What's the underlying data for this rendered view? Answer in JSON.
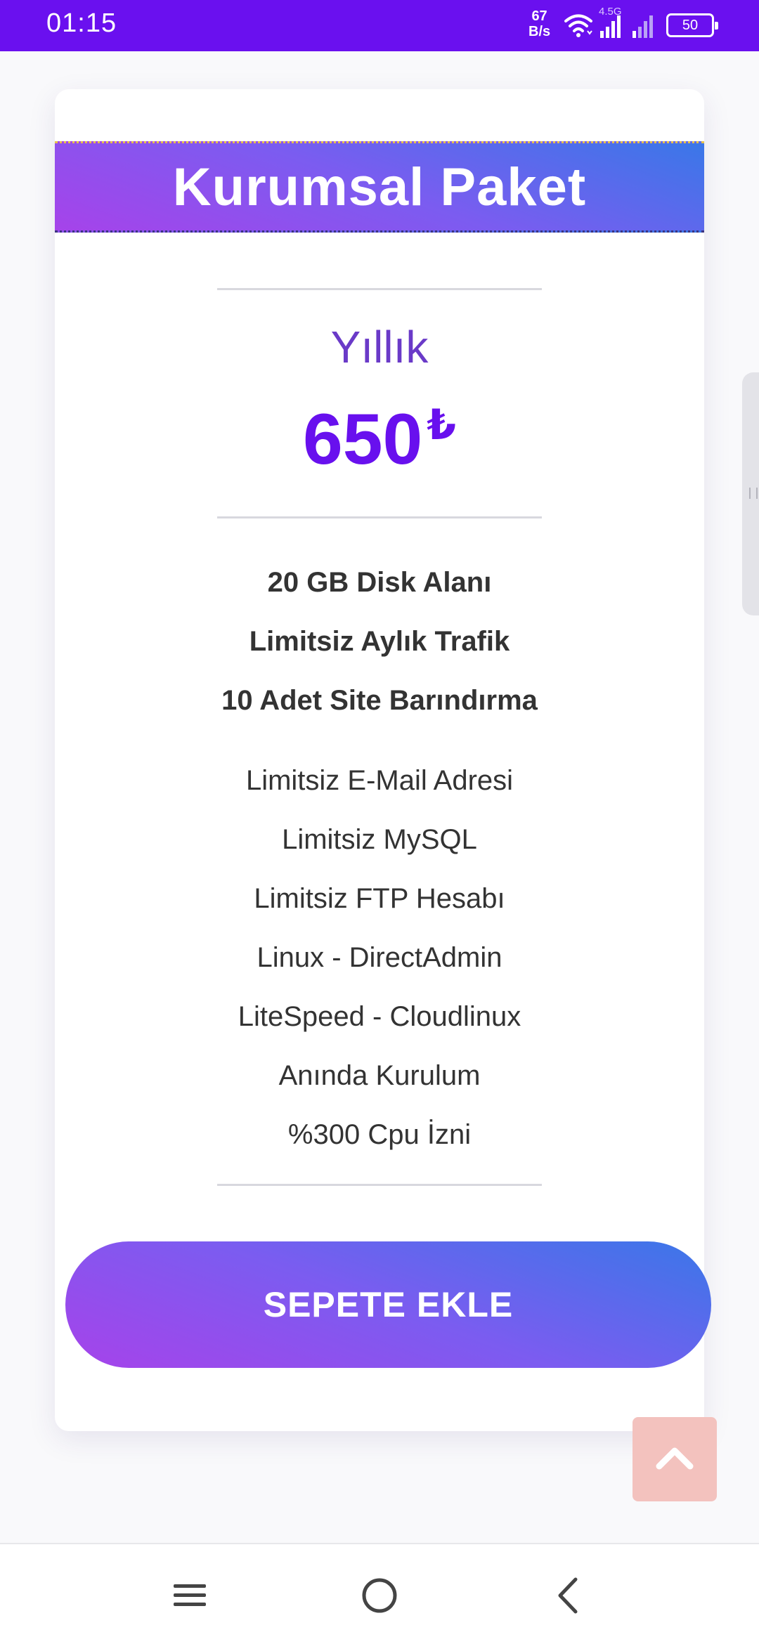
{
  "status_bar": {
    "time": "01:15",
    "net_speed_value": "67",
    "net_speed_unit": "B/s",
    "network_type": "4.5G",
    "battery": "50",
    "icons": [
      "wifi-icon",
      "signal-icon",
      "signal-weak-icon",
      "battery-icon"
    ]
  },
  "package": {
    "title": "Kurumsal Paket",
    "period": "Yıllık",
    "price": "650",
    "currency": "₺",
    "highlights": [
      "20 GB Disk Alanı",
      "Limitsiz Aylık Trafik",
      "10 Adet Site Barındırma"
    ],
    "features": [
      "Limitsiz E-Mail Adresi",
      "Limitsiz MySQL",
      "Limitsiz FTP Hesabı",
      "Linux - DirectAdmin",
      "LiteSpeed - Cloudlinux",
      "Anında Kurulum",
      "%300 Cpu İzni"
    ],
    "cta_label": "SEPETE EKLE"
  },
  "colors": {
    "status_bar": "#6a10ef",
    "price": "#6810ee",
    "gradient_start": "#a643ea",
    "gradient_end": "#3a77e8",
    "back_to_top": "#f3c2be"
  },
  "controls": {
    "back_to_top_icon": "chevron-up-icon",
    "nav_icons": [
      "menu-icon",
      "home-circle-icon",
      "back-chevron-icon"
    ]
  }
}
